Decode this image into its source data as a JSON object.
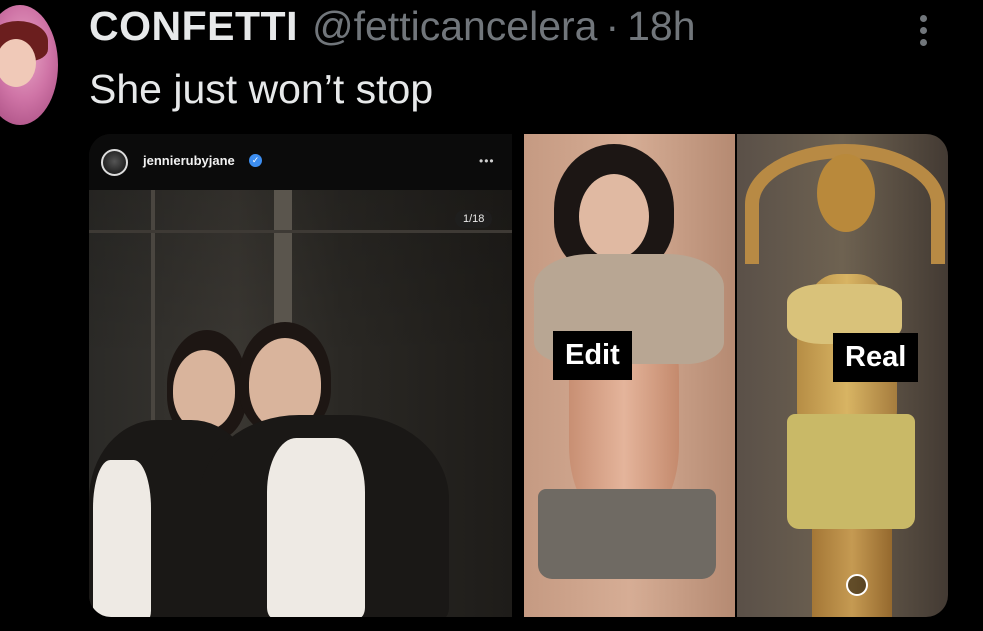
{
  "tweet": {
    "display_name": "CONFETTI",
    "handle": "@fetticancelera",
    "separator": "·",
    "timestamp": "18h",
    "text": "She just won’t stop"
  },
  "media": {
    "left_image": {
      "username": "jennierubyjane",
      "more_glyph": "•••",
      "counter": "1/18"
    },
    "right_image": {
      "label_edit": "Edit",
      "label_real": "Real"
    }
  },
  "colors": {
    "background": "#000000",
    "primary_text": "#e7e9ea",
    "secondary_text": "#71767b",
    "verified_badge": "#3d8ef0"
  },
  "icons": {
    "more": "more-vertical-icon",
    "verified": "verified-badge-icon",
    "alt_info": "info-circle-icon"
  }
}
